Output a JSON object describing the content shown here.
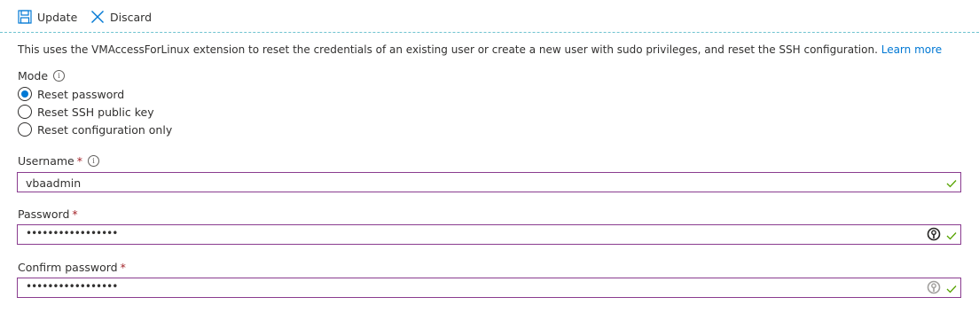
{
  "toolbar": {
    "update_label": "Update",
    "discard_label": "Discard"
  },
  "description": {
    "text": "This uses the VMAccessForLinux extension to reset the credentials of an existing user or create a new user with sudo privileges, and reset the SSH configuration.",
    "link": "Learn more"
  },
  "mode": {
    "label": "Mode",
    "info_icon": "i",
    "options": [
      {
        "label": "Reset password",
        "selected": true
      },
      {
        "label": "Reset SSH public key",
        "selected": false
      },
      {
        "label": "Reset configuration only",
        "selected": false
      }
    ]
  },
  "username": {
    "label": "Username",
    "required_marker": "*",
    "info_icon": "i",
    "value": "vbaadmin"
  },
  "password": {
    "label": "Password",
    "required_marker": "*",
    "masked_value": "•••••••••••••••••"
  },
  "confirm_password": {
    "label": "Confirm password",
    "required_marker": "*",
    "masked_value": "•••••••••••••••••"
  },
  "colors": {
    "accent": "#0078d4",
    "input_border": "#8a3c8f",
    "valid_check": "#57a300",
    "required": "#a4262c"
  }
}
